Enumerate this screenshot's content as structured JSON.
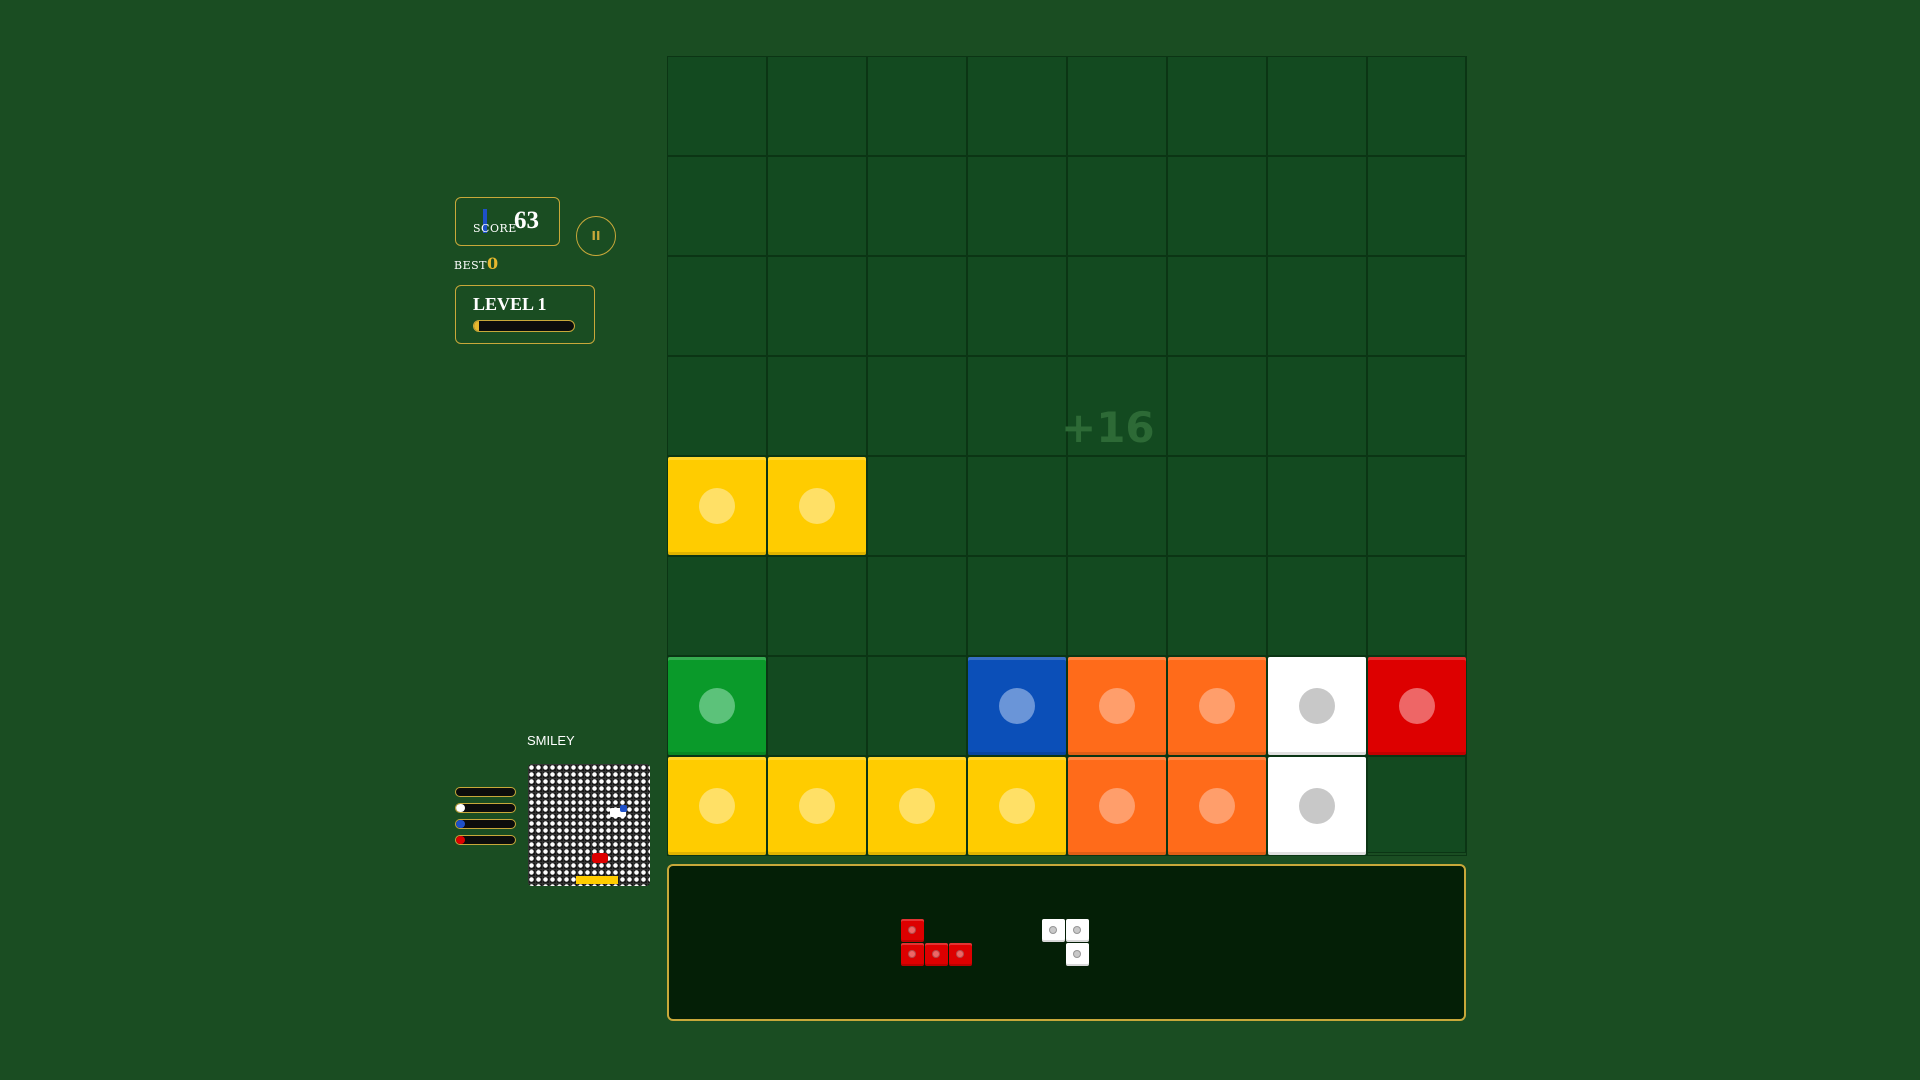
{
  "score": {
    "label": "SCORE",
    "value": "63"
  },
  "pause": {
    "icon": "pause-icon",
    "glyph": "II"
  },
  "best": {
    "label": "BEST",
    "value": "0"
  },
  "level": {
    "label": "LEVEL 1",
    "progress": 0.05
  },
  "board": {
    "rows": 8,
    "cols": 8,
    "cells": [
      [
        null,
        null,
        null,
        null,
        null,
        null,
        null,
        null
      ],
      [
        null,
        null,
        null,
        null,
        null,
        null,
        null,
        null
      ],
      [
        null,
        null,
        null,
        null,
        null,
        null,
        null,
        null
      ],
      [
        null,
        null,
        null,
        null,
        null,
        null,
        null,
        null
      ],
      [
        "yellow",
        "yellow",
        null,
        null,
        null,
        null,
        null,
        null
      ],
      [
        null,
        null,
        null,
        null,
        null,
        null,
        null,
        null
      ],
      [
        "green",
        null,
        null,
        "blue",
        "orange",
        "orange",
        "white",
        "red"
      ],
      [
        "yellow",
        "yellow",
        "yellow",
        "yellow",
        "orange",
        "orange",
        "white",
        null
      ]
    ],
    "float_score": "+16"
  },
  "colors": {
    "yellow": {
      "base": "#ffcc00",
      "dot": "#ffe066"
    },
    "green": {
      "base": "#0a9a2a",
      "dot": "#5cc27a"
    },
    "blue": {
      "base": "#0b4fb8",
      "dot": "#6a95d8"
    },
    "orange": {
      "base": "#ff6b1a",
      "dot": "#ff9e6b"
    },
    "white": {
      "base": "#ffffff",
      "dot": "#c8c8c8"
    },
    "red": {
      "base": "#dd0000",
      "dot": "#ee6666"
    },
    "background": "#1a4d22",
    "accent": "#c8a83a"
  },
  "tray": {
    "pieces": [
      {
        "color": "red",
        "cells": [
          [
            0,
            0
          ],
          [
            1,
            0
          ],
          [
            1,
            1
          ],
          [
            1,
            2
          ]
        ]
      },
      {
        "color": "white",
        "cells": [
          [
            0,
            0
          ],
          [
            0,
            1
          ],
          [
            1,
            1
          ]
        ]
      }
    ]
  },
  "theme": {
    "label": "SMILEY",
    "bars": [
      {
        "color": "#ffffff",
        "fill": 0.0
      },
      {
        "color": "#ffffff",
        "fill": 0.15
      },
      {
        "color": "#1e50c8",
        "fill": 0.15
      },
      {
        "color": "#dd0000",
        "fill": 0.15
      }
    ]
  }
}
